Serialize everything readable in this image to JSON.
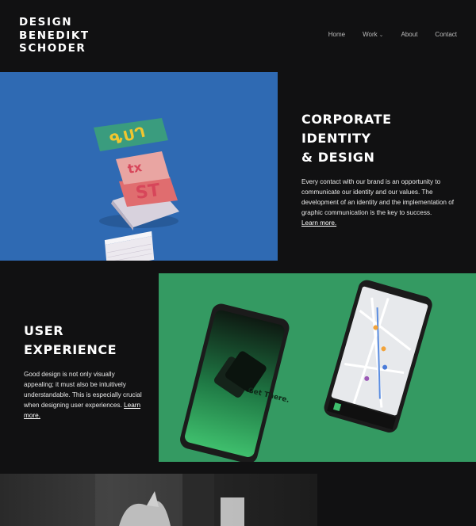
{
  "logo": {
    "lines": [
      "DESIGN",
      "BENEDIKT",
      "SCHODER"
    ]
  },
  "nav": {
    "items": [
      "Home",
      "Work",
      "About",
      "Contact"
    ]
  },
  "sections": [
    {
      "title_lines": [
        "CORPORATE",
        "IDENTITY",
        "& DESIGN"
      ],
      "body": "Every contact with our brand is an opportunity to communicate our identity and our values. The development of an identity and the implementation of graphic communication is the key to success.",
      "link": "Learn more.",
      "image_bg": "#2f6ab3"
    },
    {
      "title_lines": [
        "USER",
        "EXPERIENCE"
      ],
      "body": "Good design is not only visually appealing; it must also be intuitively understandable. This is especially crucial when designing user experiences.",
      "link": "Learn more.",
      "image_bg": "#349a62",
      "phone_text": "Get There."
    }
  ],
  "colors": {
    "background": "#111112",
    "blue": "#2f6ab3",
    "green": "#349a62"
  }
}
